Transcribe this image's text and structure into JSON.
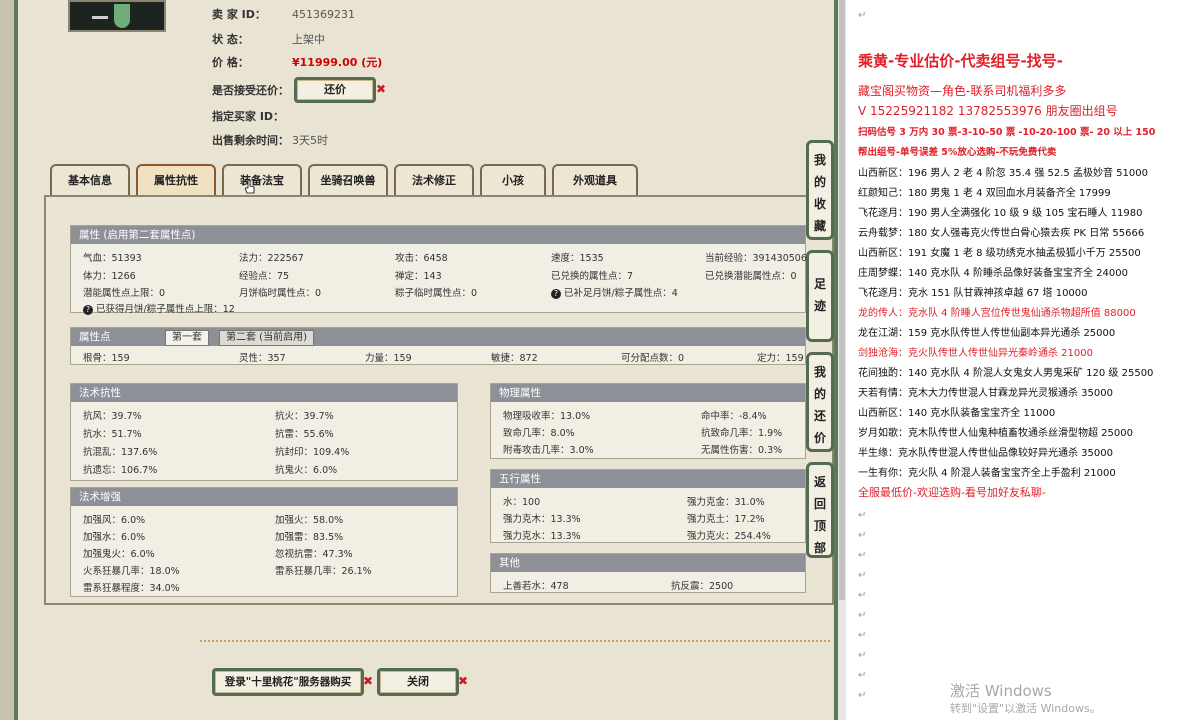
{
  "seller": {
    "id_label": "卖  家    ID：",
    "id_value": "451369231",
    "status_label": "状        态：",
    "status_value": "上架中",
    "price_label": "价        格：",
    "price_value": "¥11999.00 (元)",
    "counter_label": "是否接受还价：",
    "counter_button": "还价",
    "buyer_label": "指定买家 ID：",
    "remain_label": "出售剩余时间：",
    "remain_value": "3天5时"
  },
  "tabs": [
    "基本信息",
    "属性抗性",
    "装备法宝",
    "坐骑召唤兽",
    "法术修正",
    "小孩",
    "外观道具"
  ],
  "attr": {
    "header": "属性 (启用第二套属性点)",
    "row1": [
      "气血：51393",
      "法力：222567",
      "攻击：6458",
      "速度：1535",
      "当前经验：391430506"
    ],
    "row2": [
      "体力：1266",
      "经验点：75",
      "禅定：143",
      "已兑换的属性点：7",
      "已兑换潜能属性点：0"
    ],
    "row3": [
      "潜能属性点上限：0",
      "月饼临时属性点：0",
      "粽子临时属性点：0",
      "已补足月饼/粽子属性点：4"
    ],
    "row4": "已获得月饼/粽子属性点上限：12",
    "help_icon": "?"
  },
  "points": {
    "header": "属性点",
    "tab1": "第一套",
    "tab2": "第二套 (当前启用)",
    "values": [
      "根骨：159",
      "灵性：357",
      "力量：159",
      "敏捷：872",
      "可分配点数：0",
      "定力：159"
    ]
  },
  "resist": {
    "header": "法术抗性",
    "items": [
      [
        "抗风：39.7%",
        "抗火：39.7%"
      ],
      [
        "抗水：51.7%",
        "抗雷：55.6%"
      ],
      [
        "抗混乱：137.6%",
        "抗封印：109.4%"
      ],
      [
        "抗遗忘：106.7%",
        "抗鬼火：6.0%"
      ]
    ]
  },
  "enhance": {
    "header": "法术增强",
    "items": [
      [
        "加强风：6.0%",
        "加强火：58.0%"
      ],
      [
        "加强水：6.0%",
        "加强雷：83.5%"
      ],
      [
        "加强鬼火：6.0%",
        "忽视抗雷：47.3%"
      ],
      [
        "火系狂暴几率：18.0%",
        "雷系狂暴几率：26.1%"
      ],
      [
        "雷系狂暴程度：34.0%",
        ""
      ]
    ]
  },
  "physical": {
    "header": "物理属性",
    "items": [
      [
        "物理吸收率：13.0%",
        "命中率：-8.4%"
      ],
      [
        "致命几率：8.0%",
        "抗致命几率：1.9%"
      ],
      [
        "附毒攻击几率：3.0%",
        "无属性伤害：0.3%"
      ]
    ]
  },
  "five": {
    "header": "五行属性",
    "items": [
      [
        "水：100",
        "强力克金：31.0%"
      ],
      [
        "强力克木：13.3%",
        "强力克土：17.2%"
      ],
      [
        "强力克水：13.3%",
        "强力克火：254.4%"
      ]
    ]
  },
  "other": {
    "header": "其他",
    "items": [
      [
        "上善若水：478",
        "抗反震：2500"
      ]
    ]
  },
  "bottom": {
    "login_button": "登录\"十里桃花\"服务器购买",
    "close_button": "关闭"
  },
  "side": [
    "我的收藏",
    "足迹",
    "我的还价",
    "返回顶部"
  ],
  "doc": {
    "title": "乘黄-专业估价-代卖组号-找号-",
    "l1": "藏宝阁买物资—角色-联系司机福利多多",
    "l2": "V 15225921182   13782553976 朋友圈出组号",
    "l3": "扫码估号 3 万内 30 票-3-10-50 票  -10-20-100 票- 20 以上 150",
    "l4": "帮出组号-单号误差 5%放心选购-不玩免费代卖",
    "items": [
      "山西新区：196 男人 2 老 4 阶忽 35.4 强 52.5 孟极妙音 51000",
      "红颜知己：180 男鬼 1 老 4 双回血水月装备齐全 17999",
      "飞花逐月：190 男人全满强化 10 级 9 级 105 宝石睡人 11980",
      "云舟载梦：180 女人强毒克火传世白骨心猿去疾 PK 日常 55666",
      "山西新区：191 女魔 1 老 8 级功绣克水抽孟极狐小千万 25500",
      "庄周梦蝶：140 克水队 4 阶睡杀品像好装备宝宝齐全 24000",
      "飞花逐月：克水 151 队甘霖神孩卓越 67 塔 10000",
      "龙的传人：克水队 4 阶睡人宫位传世鬼仙通杀物超所值 88000",
      "龙在江湖：159 克水队传世人传世仙副本异光通杀 25000",
      "剑独沧海：克火队传世人传世仙异光秦岭通杀 21000",
      "花间独酌：140 克水队 4 阶混人女鬼女人男鬼采矿 120 级 25500",
      "天若有情：克木大力传世混人甘霖龙异光灵猴通杀 35000",
      "山西新区：140 克水队装备宝宝齐全 11000",
      "岁月如歌：克木队传世人仙鬼种植畜牧通杀丝滑型物超 25000",
      "半生缘：克水队传世混人传世仙品像较好异光通杀 35000",
      "一生有你：克火队 4 阶混人装备宝宝齐全上手盈利 21000"
    ],
    "footer": "全服最低价-欢迎选购-看号加好友私聊-",
    "return_mark": "↵"
  },
  "watermark": {
    "line1": "激活 Windows",
    "line2": "转到\"设置\"以激活 Windows。"
  },
  "colors": {
    "frame": "#5a7a52",
    "price": "#d00000",
    "doc_red": "#e0202a",
    "header_gray": "#8e9098"
  }
}
